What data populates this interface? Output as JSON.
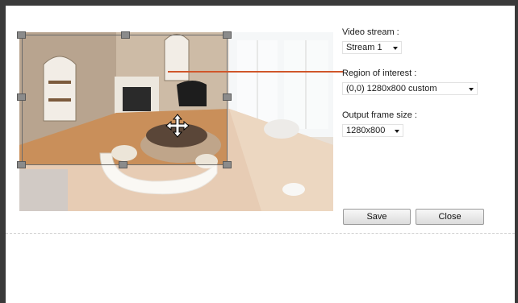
{
  "video_stream": {
    "label": "Video stream :",
    "value": "Stream 1"
  },
  "region_of_interest": {
    "label": "Region of interest :",
    "value": "(0,0) 1280x800 custom"
  },
  "output_frame_size": {
    "label": "Output frame size :",
    "value": "1280x800"
  },
  "buttons": {
    "save": "Save",
    "close": "Close"
  },
  "colors": {
    "connector": "#d0562a",
    "handle": "#8b8b8b"
  },
  "icons": {
    "move": "move-cursor-icon",
    "dropdown": "chevron-down-icon"
  }
}
